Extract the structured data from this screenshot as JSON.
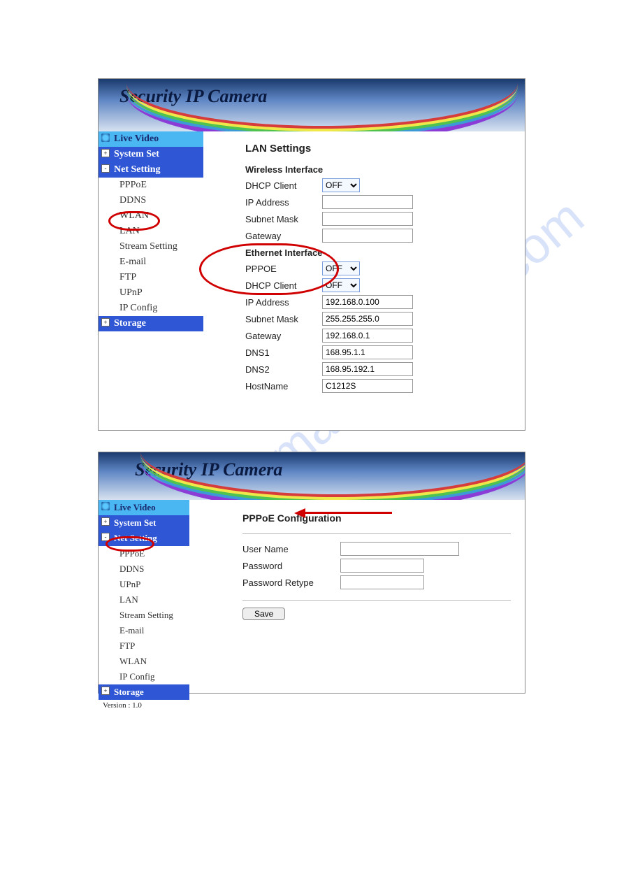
{
  "watermark_text": "manualshive.com",
  "panel1": {
    "banner_title": "Security IP Camera",
    "sidebar": {
      "live": "Live Video",
      "system_set": "System Set",
      "net_setting": "Net Setting",
      "items": [
        {
          "label": "PPPoE"
        },
        {
          "label": "DDNS"
        },
        {
          "label": "WLAN"
        },
        {
          "label": "LAN"
        },
        {
          "label": "Stream Setting"
        },
        {
          "label": "E-mail"
        },
        {
          "label": "FTP"
        },
        {
          "label": "UPnP"
        },
        {
          "label": "IP Config"
        }
      ],
      "storage": "Storage"
    },
    "main": {
      "title": "LAN Settings",
      "section_wireless": "Wireless Interface",
      "wireless": {
        "dhcp_label": "DHCP Client",
        "dhcp_value": "OFF",
        "ip_label": "IP Address",
        "ip_value": "",
        "mask_label": "Subnet Mask",
        "mask_value": "",
        "gw_label": "Gateway",
        "gw_value": ""
      },
      "section_ethernet": "Ethernet Interface",
      "ethernet": {
        "pppoe_label": "PPPOE",
        "pppoe_value": "OFF",
        "dhcp_label": "DHCP Client",
        "dhcp_value": "OFF",
        "ip_label": "IP Address",
        "ip_value": "192.168.0.100",
        "mask_label": "Subnet Mask",
        "mask_value": "255.255.255.0",
        "gw_label": "Gateway",
        "gw_value": "192.168.0.1",
        "dns1_label": "DNS1",
        "dns1_value": "168.95.1.1",
        "dns2_label": "DNS2",
        "dns2_value": "168.95.192.1",
        "host_label": "HostName",
        "host_value": "C1212S"
      }
    }
  },
  "panel2": {
    "banner_title": "Security IP Camera",
    "sidebar": {
      "live": "Live Video",
      "system_set": "System Set",
      "net_setting": "Net Setting",
      "items": [
        {
          "label": "PPPoE"
        },
        {
          "label": "DDNS"
        },
        {
          "label": "UPnP"
        },
        {
          "label": "LAN"
        },
        {
          "label": "Stream Setting"
        },
        {
          "label": "E-mail"
        },
        {
          "label": "FTP"
        },
        {
          "label": "WLAN"
        },
        {
          "label": "IP Config"
        }
      ],
      "storage": "Storage",
      "version_label": "Version : 1.0"
    },
    "main": {
      "title": "PPPoE Configuration",
      "user_label": "User Name",
      "user_value": "",
      "pw_label": "Password",
      "pw_value": "",
      "pw2_label": "Password Retype",
      "pw2_value": "",
      "save_label": "Save"
    }
  }
}
